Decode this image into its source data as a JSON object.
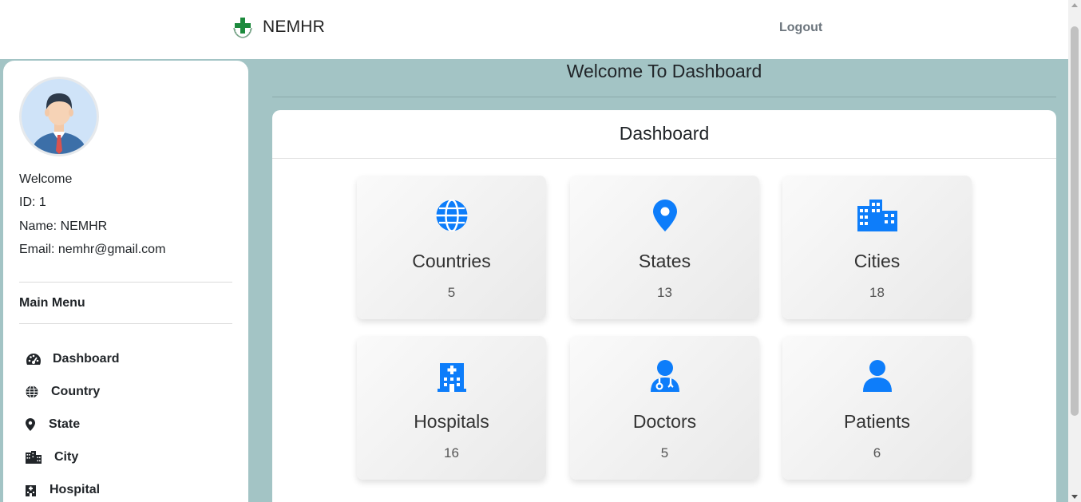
{
  "header": {
    "brand_name": "NEMHR",
    "logout_label": "Logout"
  },
  "sidebar": {
    "avatar": "user-avatar",
    "info": {
      "welcome": "Welcome",
      "id": "ID: 1",
      "name": "Name: NEMHR",
      "email": "Email: nemhr@gmail.com"
    },
    "menu_title": "Main Menu",
    "items": [
      {
        "label": "Dashboard",
        "icon": "gauge-icon"
      },
      {
        "label": "Country",
        "icon": "globe-icon"
      },
      {
        "label": "State",
        "icon": "location-pin-icon"
      },
      {
        "label": "City",
        "icon": "city-icon"
      },
      {
        "label": "Hospital",
        "icon": "hospital-icon"
      }
    ]
  },
  "main": {
    "title": "Welcome To Dashboard",
    "panel_title": "Dashboard",
    "cards": [
      {
        "label": "Countries",
        "count": "5",
        "icon": "globe-icon"
      },
      {
        "label": "States",
        "count": "13",
        "icon": "location-pin-icon"
      },
      {
        "label": "Cities",
        "count": "18",
        "icon": "city-icon"
      },
      {
        "label": "Hospitals",
        "count": "16",
        "icon": "hospital-icon"
      },
      {
        "label": "Doctors",
        "count": "5",
        "icon": "doctor-icon"
      },
      {
        "label": "Patients",
        "count": "6",
        "icon": "user-icon"
      }
    ]
  },
  "colors": {
    "accent_blue": "#0d7dfa",
    "page_background": "#a3c4c5",
    "logo_green": "#1c8a3c"
  }
}
